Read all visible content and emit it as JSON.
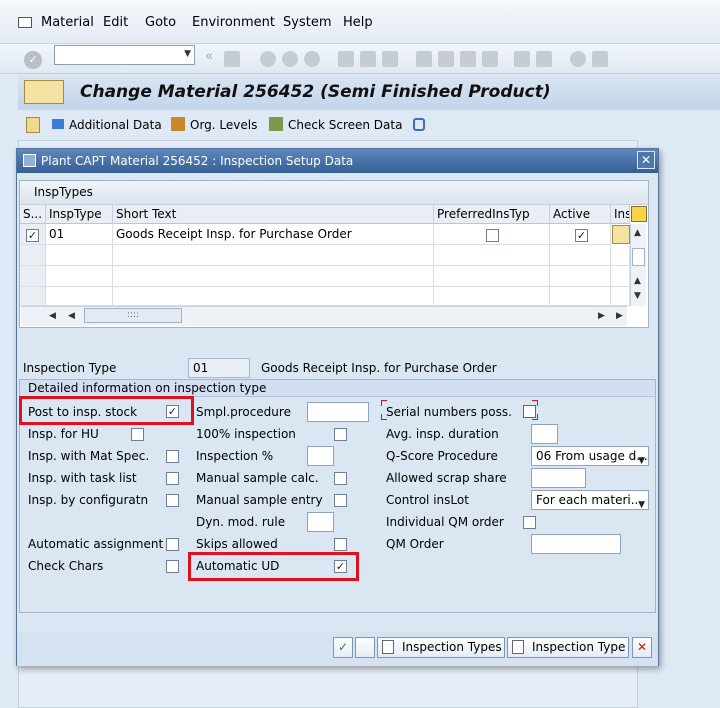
{
  "menu": [
    "Material",
    "Edit",
    "Goto",
    "Environment",
    "System",
    "Help"
  ],
  "title": "Change Material 256452 (Semi Finished Product)",
  "app_toolbar": {
    "additional_data": "Additional Data",
    "org_levels": "Org. Levels",
    "check_screen_data": "Check Screen Data"
  },
  "dialog": {
    "title": "Plant CAPT Material 256452 : Inspection Setup Data",
    "table_caption": "InspTypes",
    "columns": [
      "S...",
      "InspType",
      "Short Text",
      "PreferredInsTyp",
      "Active",
      "Ins"
    ],
    "rows": [
      {
        "selected": true,
        "insp_type": "01",
        "short_text": "Goods Receipt Insp. for Purchase Order",
        "preferred": false,
        "active": true
      }
    ],
    "scroll_thumb": "::::",
    "inspection_type_label": "Inspection Type",
    "inspection_type_value": "01",
    "inspection_type_text": "Goods Receipt Insp. for Purchase Order",
    "group_title": "Detailed information on inspection type",
    "col1": [
      {
        "label": "Post to insp. stock",
        "checked": true
      },
      {
        "label": "Insp. for HU",
        "checked": false
      },
      {
        "label": "Insp. with Mat Spec.",
        "checked": false
      },
      {
        "label": "Insp. with task list",
        "checked": false
      },
      {
        "label": "Insp. by configuratn",
        "checked": false
      },
      {
        "label": "Automatic assignment",
        "checked": false
      },
      {
        "label": "Check Chars",
        "checked": false
      }
    ],
    "col2": {
      "smpl_procedure": "Smpl.procedure",
      "inspection_100": "100% inspection",
      "inspection_pct": "Inspection %",
      "manual_sample_calc": "Manual sample calc.",
      "manual_sample_entry": "Manual sample entry",
      "dyn_mod_rule": "Dyn. mod. rule",
      "skips_allowed": "Skips allowed",
      "automatic_ud": "Automatic UD",
      "automatic_ud_checked": true
    },
    "col3": {
      "serial_numbers": "Serial numbers poss.",
      "avg_insp_duration": "Avg. insp. duration",
      "qscore_procedure": "Q-Score Procedure",
      "qscore_value": "06 From usage d...",
      "allowed_scrap": "Allowed scrap share",
      "control_inslot": "Control insLot",
      "control_inslot_value": "For each materi...",
      "individual_qm": "Individual QM order",
      "qm_order": "QM Order"
    },
    "buttons": {
      "inspection_types": "Inspection Types",
      "inspection_type": "Inspection Type"
    }
  },
  "colors": {
    "highlight": "#e0101e",
    "title_bar": "#345f95",
    "background": "#dfe9f5"
  }
}
